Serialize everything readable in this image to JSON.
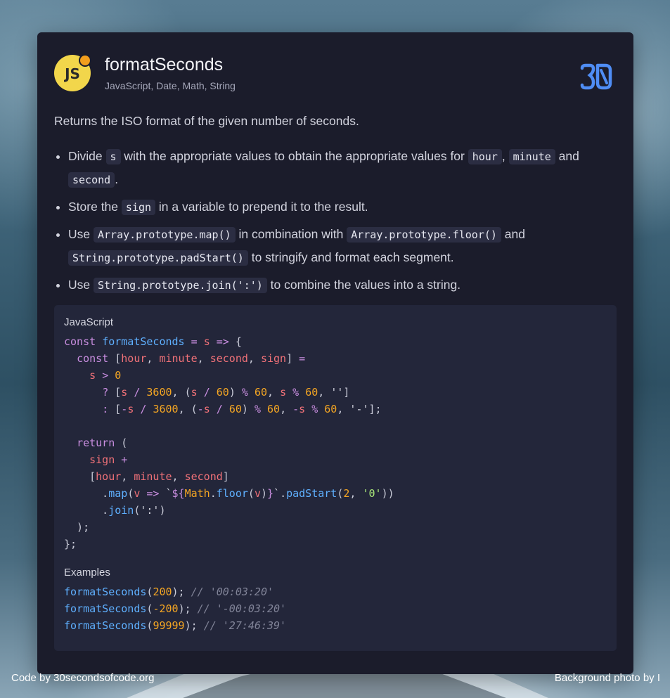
{
  "colors": {
    "card_bg": "#1b1c2b",
    "code_bg": "#23263a",
    "js_badge": "#f2d64b",
    "js_dot": "#f29e1d",
    "logo_blue": "#4f8df5",
    "keyword": "#c98ee0",
    "function": "#5fb0ff",
    "variable": "#f07178",
    "number": "#f5a623"
  },
  "snippet": {
    "badge": "JS",
    "title": "formatSeconds",
    "tags": "JavaScript, Date, Math, String",
    "logo_icon": "30-seconds-logo-icon",
    "description": "Returns the ISO format of the given number of seconds."
  },
  "steps": [
    {
      "t1": "Divide ",
      "c1": "s",
      "t2": " with the appropriate values to obtain the appropriate values for ",
      "c2": "hour",
      "t3": ", ",
      "c3": "minute",
      "t4": " and ",
      "c4": "second",
      "t5": "."
    },
    {
      "t1": "Store the ",
      "c1": "sign",
      "t2": " in a variable to prepend it to the result."
    },
    {
      "t1": "Use ",
      "c1": "Array.prototype.map()",
      "t2": " in combination with ",
      "c2": "Array.prototype.floor()",
      "t3": " and ",
      "c3": "String.prototype.padStart()",
      "t4": " to stringify and format each segment."
    },
    {
      "t1": "Use ",
      "c1": "String.prototype.join(':')",
      "t2": " to combine the values into a string."
    }
  ],
  "code": {
    "language": "JavaScript",
    "examples_label": "Examples",
    "source": "const formatSeconds = s => {\n  const [hour, minute, second, sign] =\n    s > 0\n      ? [s / 3600, (s / 60) % 60, s % 60, '']\n      : [-s / 3600, (-s / 60) % 60, -s % 60, '-'];\n\n  return (\n    sign +\n    [hour, minute, second]\n      .map(v => `${Math.floor(v)}`.padStart(2, '0'))\n      .join(':')\n  );\n};",
    "examples": [
      {
        "call": "formatSeconds",
        "arg": "200",
        "comment": "// '00:03:20'"
      },
      {
        "call": "formatSeconds",
        "arg": "-200",
        "comment": "// '-00:03:20'"
      },
      {
        "call": "formatSeconds",
        "arg": "99999",
        "comment": "// '27:46:39'"
      }
    ]
  },
  "footer": {
    "left": "Code by 30secondsofcode.org",
    "right": "Background photo by I"
  }
}
